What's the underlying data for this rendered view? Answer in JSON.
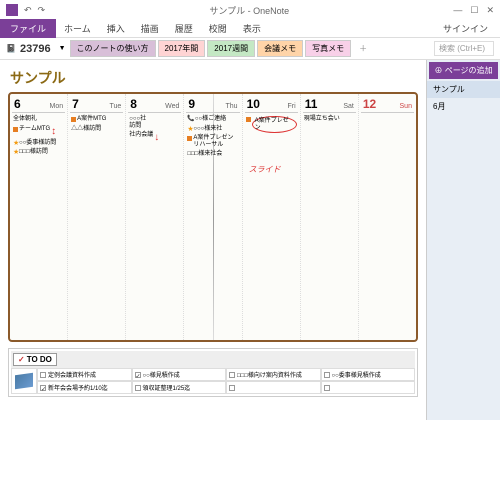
{
  "window": {
    "title": "サンプル - OneNote",
    "min": "—",
    "max": "☐",
    "close": "✕",
    "undo": "↶",
    "redo": "↷"
  },
  "ribbon": {
    "file": "ファイル",
    "tabs": [
      "ホーム",
      "挿入",
      "描画",
      "履歴",
      "校閲",
      "表示"
    ],
    "signin": "サインイン"
  },
  "notebook": {
    "name": "23796",
    "sections": [
      {
        "label": "このノートの使い方",
        "bg": "#d8bfd8"
      },
      {
        "label": "2017年間",
        "bg": "#ffd4d4"
      },
      {
        "label": "2017週間",
        "bg": "#c4e8c4"
      },
      {
        "label": "会議メモ",
        "bg": "#ffd4a8"
      },
      {
        "label": "写真メモ",
        "bg": "#f8d0e8"
      }
    ],
    "add": "＋",
    "search_ph": "検索 (Ctrl+E)"
  },
  "side": {
    "add_page": "⊕ ページの追加",
    "pages": [
      "サンプル",
      "6月"
    ]
  },
  "page": {
    "title": "サンプル"
  },
  "days": [
    {
      "num": "6",
      "name": "Mon",
      "cls": "",
      "events": [
        {
          "mk": "",
          "txt": "全体朝礼"
        },
        {
          "mk": "sq-o",
          "txt": "チームMTG",
          "arrow": "↕"
        },
        {
          "mk": "st",
          "txt": "○○委事様訪問"
        },
        {
          "mk": "st",
          "txt": "□□□様訪問"
        }
      ]
    },
    {
      "num": "7",
      "name": "Tue",
      "cls": "",
      "events": [
        {
          "mk": "sq-o",
          "txt": "A案件MTG"
        },
        {
          "mk": "",
          "txt": "△△様訪問"
        }
      ]
    },
    {
      "num": "8",
      "name": "Wed",
      "cls": "",
      "events": [
        {
          "mk": "",
          "txt": "○○○社\n訪問"
        },
        {
          "mk": "",
          "txt": "社内会議",
          "arrow": "↓"
        }
      ]
    },
    {
      "num": "9",
      "name": "Thu",
      "cls": "",
      "events": [
        {
          "mk": "",
          "txt": "📞○○様ご連絡"
        },
        {
          "mk": "st",
          "txt": "○○○様来社"
        },
        {
          "mk": "sq-o",
          "txt": "A案件プレゼン\nリハーサル"
        },
        {
          "mk": "",
          "txt": "□□□様来社会"
        }
      ]
    },
    {
      "num": "10",
      "name": "Fri",
      "cls": "",
      "events": [
        {
          "mk": "sq-o",
          "txt": "A案件プレゼン",
          "circled": true
        }
      ],
      "annot": "スライド"
    },
    {
      "num": "11",
      "name": "Sat",
      "cls": "",
      "events": [
        {
          "mk": "",
          "txt": "現場立ち会い"
        }
      ]
    },
    {
      "num": "12",
      "name": "Sun",
      "cls": "sun",
      "events": []
    }
  ],
  "todo": {
    "label": "TO DO",
    "rows": [
      [
        {
          "c": false,
          "t": "定例会議資料作成"
        },
        {
          "c": true,
          "t": "○○様見積作成"
        },
        {
          "c": false,
          "t": "□□□様向け案内資料作成"
        },
        {
          "c": false,
          "t": "○○委事様見積作成"
        }
      ],
      [
        {
          "c": true,
          "t": "新年会会場予約1/10迄"
        },
        {
          "c": false,
          "t": "領収証整理1/25迄"
        },
        {
          "c": false,
          "t": ""
        },
        {
          "c": false,
          "t": ""
        }
      ]
    ]
  }
}
